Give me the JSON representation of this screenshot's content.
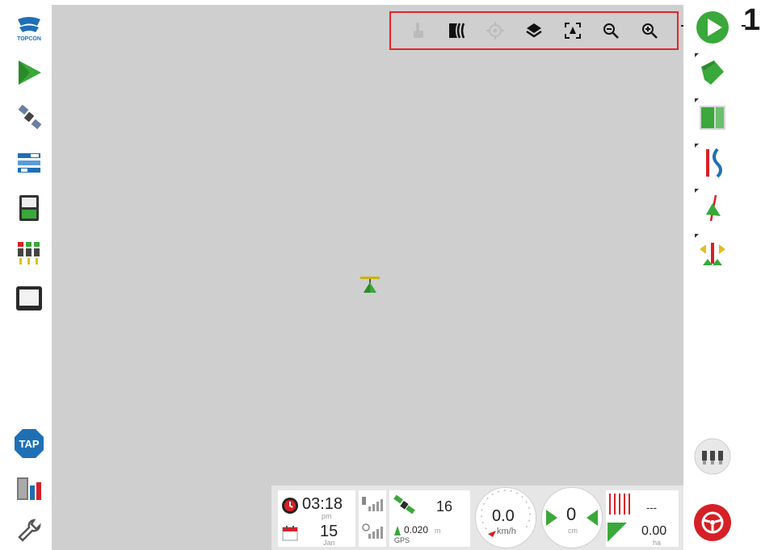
{
  "brand": {
    "logo_text": "TOPCON"
  },
  "left_toolbar": [
    {
      "name": "topcon-logo-icon"
    },
    {
      "name": "guidance-arrow-icon"
    },
    {
      "name": "gps-satellite-icon"
    },
    {
      "name": "layers-list-icon"
    },
    {
      "name": "console-icon"
    },
    {
      "name": "section-control-icon"
    },
    {
      "name": "monitor-icon"
    },
    {
      "name": "tap-icon",
      "label": "TAP"
    },
    {
      "name": "tank-icon"
    },
    {
      "name": "wrench-icon"
    }
  ],
  "map_toolbar": {
    "callout_number": "1",
    "tools": [
      "touch-icon",
      "contour-icon",
      "target-icon",
      "layers-icon",
      "zoom-extents-icon",
      "zoom-out-icon",
      "zoom-in-icon"
    ]
  },
  "right_toolbar": [
    {
      "name": "play-icon"
    },
    {
      "name": "field-icon"
    },
    {
      "name": "boundary-icon"
    },
    {
      "name": "guidelines-icon"
    },
    {
      "name": "steering-icon"
    },
    {
      "name": "nudge-icon"
    },
    {
      "name": "implement-sections-icon"
    },
    {
      "name": "steering-wheel-icon"
    }
  ],
  "status": {
    "time": "03:18",
    "time_period": "pm",
    "date_day": "15",
    "date_month": "Jan",
    "satellites": "16",
    "accuracy": "0.020",
    "accuracy_unit": "m",
    "position_source": "GPS",
    "speed": "0.0",
    "speed_unit": "km/h",
    "cross_track": "0",
    "cross_track_unit": "cm",
    "area_top": "---",
    "area": "0.00",
    "area_unit": "ha"
  },
  "colors": {
    "accent_green": "#3aa83a",
    "brand_blue": "#1f6fb5",
    "alert_red": "#d62027",
    "map_bg": "#cfcfcf"
  }
}
